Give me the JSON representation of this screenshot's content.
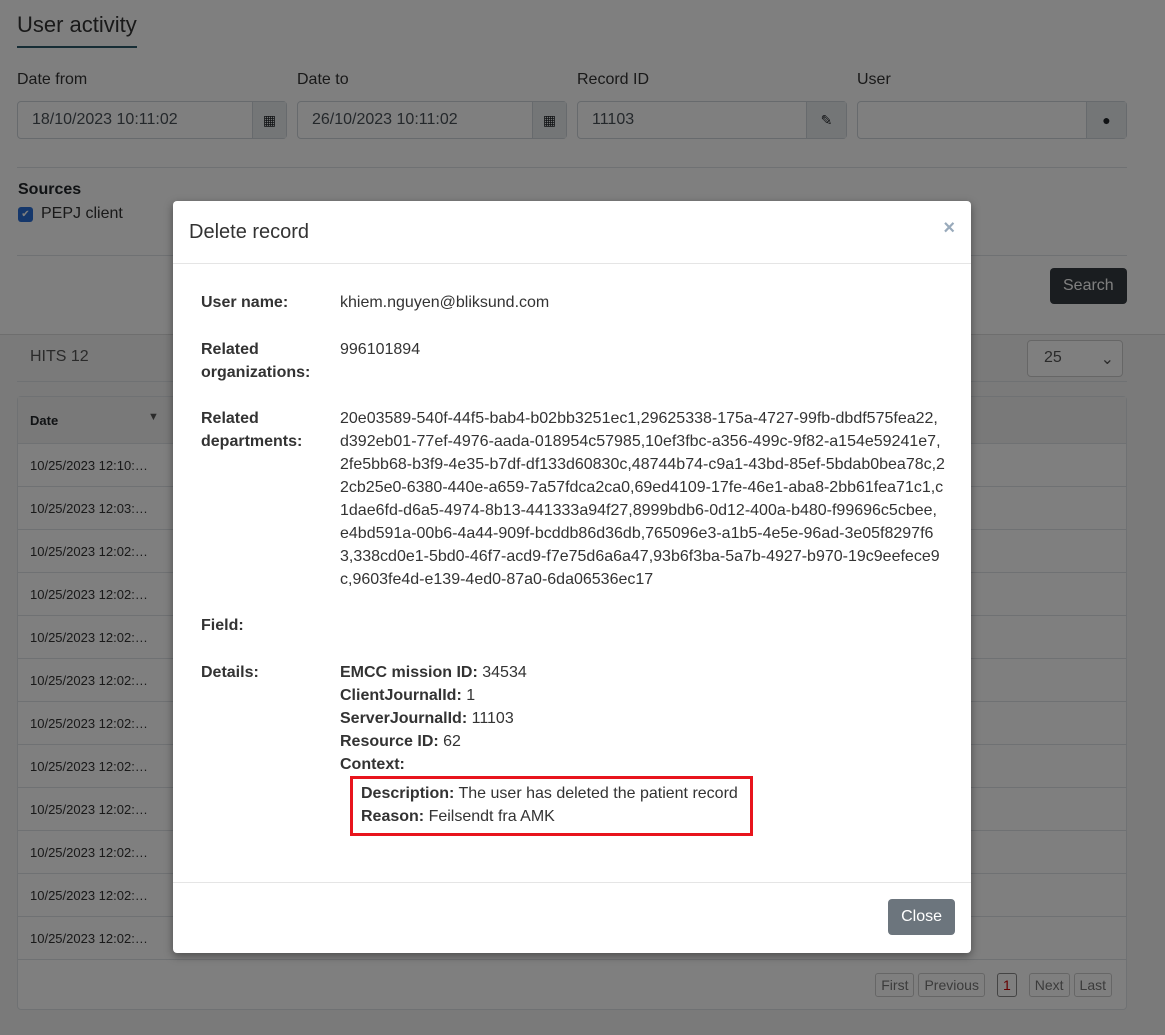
{
  "page": {
    "title": "User activity"
  },
  "filters": {
    "date_from_label": "Date from",
    "date_from": "18/10/2023 10:11:02",
    "date_to_label": "Date to",
    "date_to": "26/10/2023 10:11:02",
    "record_id_label": "Record ID",
    "record_id": "11103",
    "user_label": "User",
    "user": ""
  },
  "sources": {
    "label": "Sources",
    "items": [
      {
        "label": "PEPJ client",
        "checked": true
      }
    ]
  },
  "search_label": "Search",
  "results": {
    "hits": "HITS 12",
    "page_size": "25",
    "date_header": "Date",
    "rows": [
      "10/25/2023 12:10:…",
      "10/25/2023 12:03:…",
      "10/25/2023 12:02:…",
      "10/25/2023 12:02:…",
      "10/25/2023 12:02:…",
      "10/25/2023 12:02:…",
      "10/25/2023 12:02:…",
      "10/25/2023 12:02:…",
      "10/25/2023 12:02:…",
      "10/25/2023 12:02:…",
      "10/25/2023 12:02:…",
      "10/25/2023 12:02:…"
    ],
    "pagination": {
      "first": "First",
      "previous": "Previous",
      "current": "1",
      "next": "Next",
      "last": "Last"
    }
  },
  "modal": {
    "title": "Delete record",
    "close_x": "×",
    "user_name_label": "User name:",
    "user_name": "khiem.nguyen@bliksund.com",
    "orgs_label": "Related organizations:",
    "orgs": "996101894",
    "depts_label": "Related departments:",
    "depts": "20e03589-540f-44f5-bab4-b02bb3251ec1,29625338-175a-4727-99fb-dbdf575fea22,d392eb01-77ef-4976-aada-018954c57985,10ef3fbc-a356-499c-9f82-a154e59241e7,2fe5bb68-b3f9-4e35-b7df-df133d60830c,48744b74-c9a1-43bd-85ef-5bdab0bea78c,22cb25e0-6380-440e-a659-7a57fdca2ca0,69ed4109-17fe-46e1-aba8-2bb61fea71c1,c1dae6fd-d6a5-4974-8b13-441333a94f27,8999bdb6-0d12-400a-b480-f99696c5cbee,e4bd591a-00b6-4a44-909f-bcddb86d36db,765096e3-a1b5-4e5e-96ad-3e05f8297f63,338cd0e1-5bd0-46f7-acd9-f7e75d6a6a47,93b6f3ba-5a7b-4927-b970-19c9eefece9c,9603fe4d-e139-4ed0-87a0-6da06536ec17",
    "field_label": "Field:",
    "details_label": "Details:",
    "details": [
      {
        "k": "EMCC mission ID:",
        "v": "34534"
      },
      {
        "k": "ClientJournalId:",
        "v": "1"
      },
      {
        "k": "ServerJournalId:",
        "v": "11103"
      },
      {
        "k": "Resource ID:",
        "v": "62"
      }
    ],
    "context_label": "Context:",
    "context": [
      {
        "k": "Description:",
        "v": "The user has deleted the patient record"
      },
      {
        "k": "Reason:",
        "v": "Feilsendt fra AMK"
      }
    ],
    "close_label": "Close"
  },
  "colors": {
    "highlight": "#e8141c",
    "accent": "#2d5b6b"
  }
}
